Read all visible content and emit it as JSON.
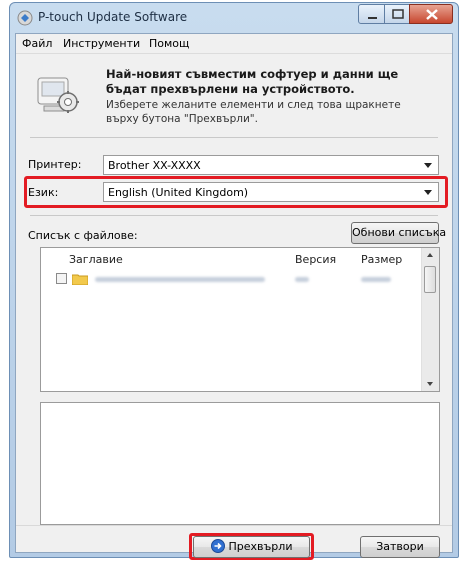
{
  "window": {
    "title": "P-touch Update Software"
  },
  "menu": {
    "file": "Файл",
    "tools": "Инструменти",
    "help": "Помощ"
  },
  "header": {
    "title": "Най-новият съвместим софтуер и данни ще бъдат прехвърлени на устройството.",
    "subtitle": "Изберете желаните елементи и след това щракнете върху бутона \"Прехвърли\"."
  },
  "printer": {
    "label": "Принтер:",
    "value": "Brother XX-XXXX"
  },
  "language": {
    "label": "Език:",
    "value": "English (United Kingdom)"
  },
  "file_list": {
    "label": "Списък с файлове:",
    "refresh_button": "Обнови списъка",
    "columns": [
      "Заглавие",
      "Версия",
      "Размер"
    ]
  },
  "buttons": {
    "transfer": "Прехвърли",
    "close": "Затвори"
  },
  "colors": {
    "highlight": "#e31b23",
    "accent": "#2f6fd1"
  },
  "icons": {
    "app": "ptouch-update-icon",
    "header": "computer-gear-icon",
    "transfer": "arrow-right-circle-icon",
    "item": "folder-icon"
  }
}
